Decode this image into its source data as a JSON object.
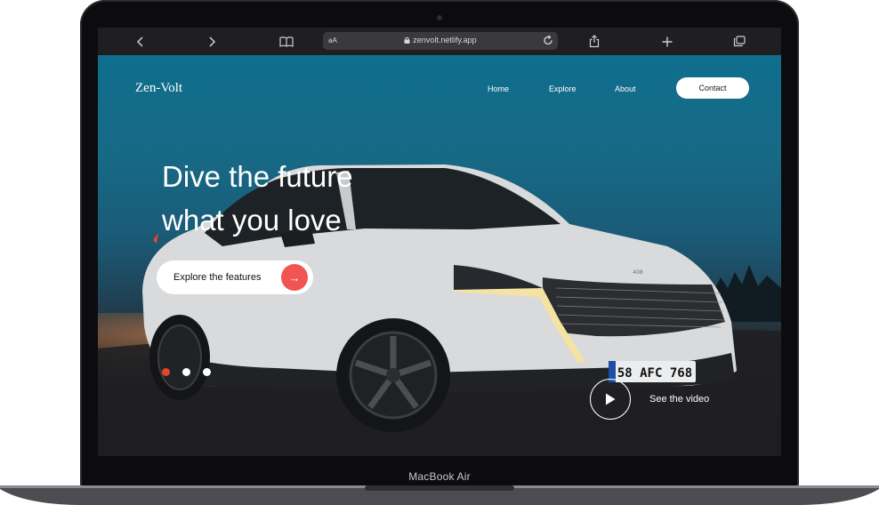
{
  "device": {
    "label": "MacBook Air"
  },
  "browser": {
    "text_size_label": "aA",
    "url": "zenvolt.netlify.app",
    "icons": [
      "back-arrow-icon",
      "forward-arrow-icon",
      "book-icon",
      "lock-icon",
      "reload-icon",
      "share-icon",
      "new-tab-icon",
      "tabs-icon"
    ]
  },
  "site": {
    "brand": "Zen-Volt",
    "nav": {
      "home": "Home",
      "explore": "Explore",
      "about": "About",
      "contact": "Contact"
    },
    "hero": {
      "headline_line1": "Dive the future",
      "headline_line2": "what you love",
      "cta_label": "Explore the features",
      "cta_icon": "arrow-right-icon",
      "video_label": "See the video",
      "video_icon": "play-icon",
      "slides_total": 3,
      "active_slide": 1
    },
    "car": {
      "plate": "58 AFC 768",
      "badge": "408"
    }
  },
  "colors": {
    "accent": "#f05453",
    "active_dot": "#e8442a",
    "sky": "#176985"
  }
}
